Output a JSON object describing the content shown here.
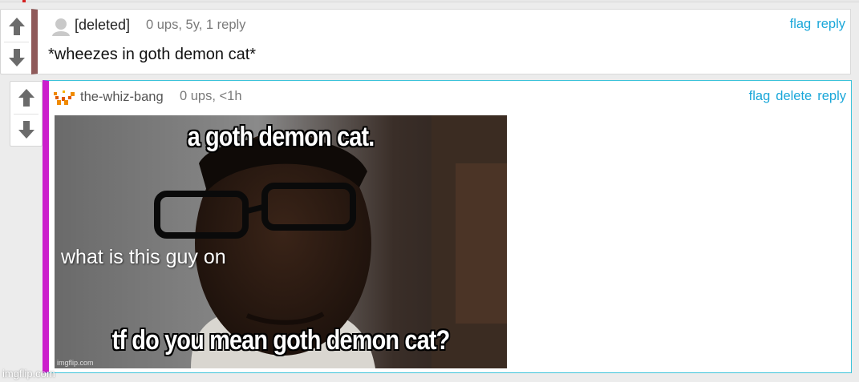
{
  "colors": {
    "accent_link": "#1aa7d9",
    "comment1_bar": "#8f5a5a",
    "comment2_bar": "#cc1fcc",
    "comment2_border": "#3cc3da",
    "vote_arrow": "#6b6b6b"
  },
  "comment1": {
    "username": "[deleted]",
    "meta": "0 ups, 5y, 1 reply",
    "text": "*wheezes in goth demon cat*",
    "avatar_icon": "default-user-icon",
    "actions": {
      "flag": "flag",
      "reply": "reply"
    }
  },
  "comment2": {
    "username": "the-whiz-bang",
    "meta": "0 ups, <1h",
    "avatar_icon": "whiz-bang-avatar-icon",
    "actions": {
      "flag": "flag",
      "delete": "delete",
      "reply": "reply"
    },
    "meme": {
      "top_text": "a goth demon cat.",
      "middle_text": "what is this guy on",
      "bottom_text": "tf do you mean goth demon cat?",
      "watermark": "imgflip.com"
    }
  },
  "page_watermark": "imgflip.com"
}
